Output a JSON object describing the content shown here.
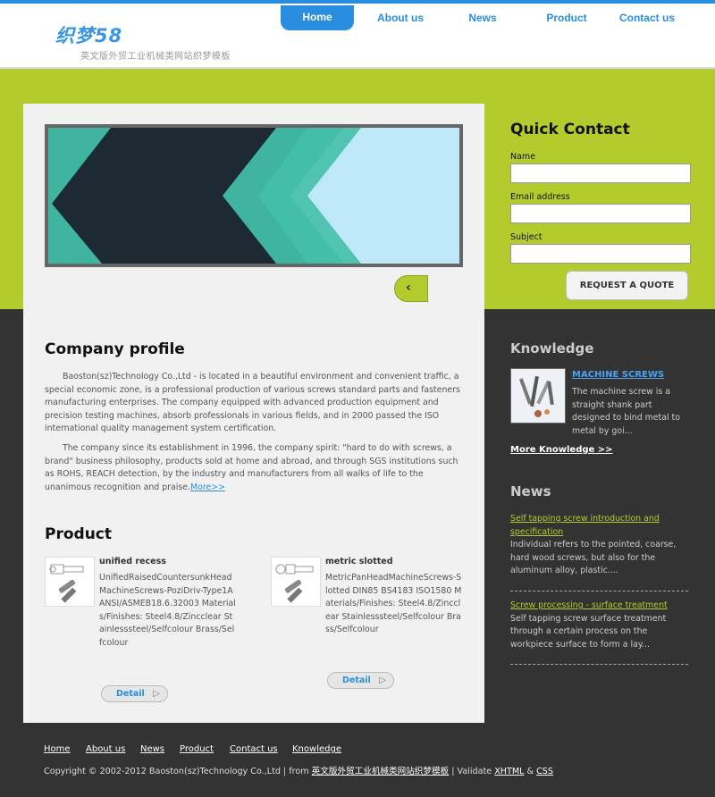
{
  "header": {
    "logo_mark": "织梦58",
    "logo_tagline": "英文版外贸工业机械类网站织梦模板",
    "nav": [
      "Home",
      "About us",
      "News",
      "Product",
      "Contact us"
    ],
    "active_nav": "Home"
  },
  "colors": {
    "accent_blue": "#2a8ee0",
    "accent_green": "#b3cb2c",
    "dark_bg": "#333333",
    "panel_bg": "#f1f1f1"
  },
  "slider": {
    "prev_glyph": "‹"
  },
  "profile": {
    "title": "Company profile",
    "p1": "Baoston(sz)Technology Co.,Ltd - is located in a beautiful environment and convenient traffic, a special economic zone, is a professional production of various screws standard parts and fasteners manufacturing enterprises. The company equipped with advanced production equipment and precision testing machines, absorb professionals in various fields, and in 2000 passed the ISO international quality management system certification.",
    "p2": "The company since its establishment in 1996, the company spirit: \"hard to do with screws, a brand\" business philosophy, products sold at home and abroad, and through SGS institutions such as ROHS, REACH detection, by the industry and manufacturers from all walks of life to the unanimous recognition and praise.",
    "more": "More>>"
  },
  "product": {
    "title": "Product",
    "items": [
      {
        "name": "unified recess",
        "desc": "UnifiedRaisedCountersunkHeadMachineScrews-PoziDriv-Type1A ANSI/ASMEB18.6.32003 Materials/Finishes: Steel4.8/Zincclear Stainlesssteel/Selfcolour Brass/Selfcolour",
        "detail": "Detail"
      },
      {
        "name": "metric slotted",
        "desc": "MetricPanHeadMachineScrews-Slotted DIN85 BS4183 ISO1580 Materials/Finishes: Steel4.8/Zincclear Stainlesssteel/Selfcolour Brass/Selfcolour",
        "detail": "Detail"
      }
    ]
  },
  "quick_contact": {
    "title": "Quick Contact",
    "name_label": "Name",
    "email_label": "Email address",
    "subject_label": "Subject",
    "button": "REQUEST A QUOTE"
  },
  "knowledge": {
    "title": "Knowledge",
    "link": "MACHINE SCREWS",
    "desc": "The machine screw is a straight shank part designed to bind metal to metal by goi...",
    "more": "More Knowledge >>"
  },
  "news": {
    "title": "News",
    "items": [
      {
        "title": "Self tapping screw introduction and specification",
        "desc": "Individual refers to the pointed, coarse, hard wood screws, but also for the aluminum alloy, plastic...."
      },
      {
        "title": "Screw processing - surface treatment",
        "desc": "Self tapping screw surface treatment through a certain process on the workpiece surface to form a lay..."
      }
    ]
  },
  "footer": {
    "nav": [
      "Home",
      "About us",
      "News",
      "Product",
      "Contact us",
      "Knowledge"
    ],
    "copyright_prefix": "Copyright © 2002-2012 Baoston(sz)Technology Co.,Ltd | from ",
    "copyright_link": "英文版外贸工业机械类网站织梦模板",
    "validate_prefix": " | Validate ",
    "xhtml": "XHTML",
    "amp": " & ",
    "css": "CSS"
  }
}
